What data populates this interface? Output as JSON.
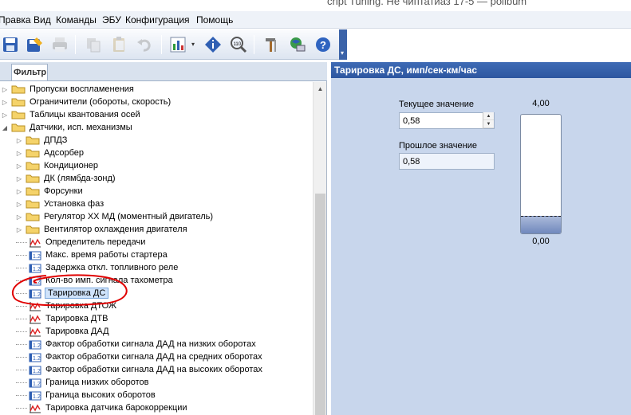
{
  "window": {
    "title_partial": "cript Tuning. Не чиптатиаз 17-5 — polibum"
  },
  "menu": {
    "items": [
      {
        "label": "Правка"
      },
      {
        "label": "Вид"
      },
      {
        "label": "Команды"
      },
      {
        "label": "ЭБУ"
      },
      {
        "label": "Конфигурация"
      },
      {
        "label": "Помощь"
      }
    ]
  },
  "toolbar": {
    "buttons": [
      {
        "name": "save-icon",
        "enabled": true
      },
      {
        "name": "save-as-icon",
        "enabled": true
      },
      {
        "name": "print-icon",
        "enabled": false
      },
      {
        "name": "copy-icon",
        "enabled": false
      },
      {
        "name": "paste-icon",
        "enabled": false
      },
      {
        "name": "undo-icon",
        "enabled": false
      },
      {
        "name": "chart-icon",
        "enabled": true
      },
      {
        "name": "diamond-info-icon",
        "enabled": true
      },
      {
        "name": "search-zoom-icon",
        "enabled": true
      },
      {
        "name": "tools-icon",
        "enabled": true
      },
      {
        "name": "network-icon",
        "enabled": true
      },
      {
        "name": "help-icon",
        "enabled": true
      }
    ]
  },
  "left_panel": {
    "tab_label": "Фильтр",
    "tree": [
      {
        "label": "Пропуски воспламенения",
        "type": "folder",
        "level": 0,
        "expanded": false
      },
      {
        "label": "Ограничители (обороты, скорость)",
        "type": "folder",
        "level": 0,
        "expanded": false
      },
      {
        "label": "Таблицы квантования осей",
        "type": "folder",
        "level": 0,
        "expanded": false
      },
      {
        "label": "Датчики, исп. механизмы",
        "type": "folder",
        "level": 0,
        "expanded": true
      },
      {
        "label": "ДПДЗ",
        "type": "folder",
        "level": 1,
        "expanded": false
      },
      {
        "label": "Адсорбер",
        "type": "folder",
        "level": 1,
        "expanded": false
      },
      {
        "label": "Кондиционер",
        "type": "folder",
        "level": 1,
        "expanded": false
      },
      {
        "label": "ДК (лямбда-зонд)",
        "type": "folder",
        "level": 1,
        "expanded": false
      },
      {
        "label": "Форсунки",
        "type": "folder",
        "level": 1,
        "expanded": false
      },
      {
        "label": "Установка фаз",
        "type": "folder",
        "level": 1,
        "expanded": false
      },
      {
        "label": "Регулятор ХХ МД (моментный двигатель)",
        "type": "folder",
        "level": 1,
        "expanded": false
      },
      {
        "label": "Вентилятор охлаждения двигателя",
        "type": "folder",
        "level": 1,
        "expanded": false
      },
      {
        "label": "Определитель передачи",
        "type": "curve",
        "level": 1
      },
      {
        "label": "Макс. время работы стартера",
        "type": "value",
        "level": 1
      },
      {
        "label": "Задержка откл. топливного реле",
        "type": "value",
        "level": 1
      },
      {
        "label": "Кол-во имп. сигнала тахометра",
        "type": "value",
        "level": 1
      },
      {
        "label": "Тарировка ДС",
        "type": "value",
        "level": 1,
        "selected": true
      },
      {
        "label": "Тарировка ДТОЖ",
        "type": "curve",
        "level": 1
      },
      {
        "label": "Тарировка ДТВ",
        "type": "curve",
        "level": 1
      },
      {
        "label": "Тарировка ДАД",
        "type": "curve",
        "level": 1
      },
      {
        "label": "Фактор обработки сигнала ДАД на низких оборотах",
        "type": "value",
        "level": 1
      },
      {
        "label": "Фактор обработки сигнала ДАД на средних оборотах",
        "type": "value",
        "level": 1
      },
      {
        "label": "Фактор обработки сигнала ДАД на высоких оборотах",
        "type": "value",
        "level": 1
      },
      {
        "label": "Граница низких оборотов",
        "type": "value",
        "level": 1
      },
      {
        "label": "Граница высоких оборотов",
        "type": "value",
        "level": 1
      },
      {
        "label": "Тарировка датчика барокоррекции",
        "type": "curve",
        "level": 1
      }
    ]
  },
  "right_panel": {
    "title": "Тарировка ДС, имп/сек-км/час",
    "current_label": "Текущее значение",
    "current_value": "0,58",
    "previous_label": "Прошлое значение",
    "previous_value": "0,58",
    "gauge": {
      "max_label": "4,00",
      "min_label": "0,00",
      "level": 0.145
    }
  },
  "colors": {
    "header": "#2d56a0",
    "panel_bg": "#c8d6ec",
    "annotation": "#e00000"
  }
}
